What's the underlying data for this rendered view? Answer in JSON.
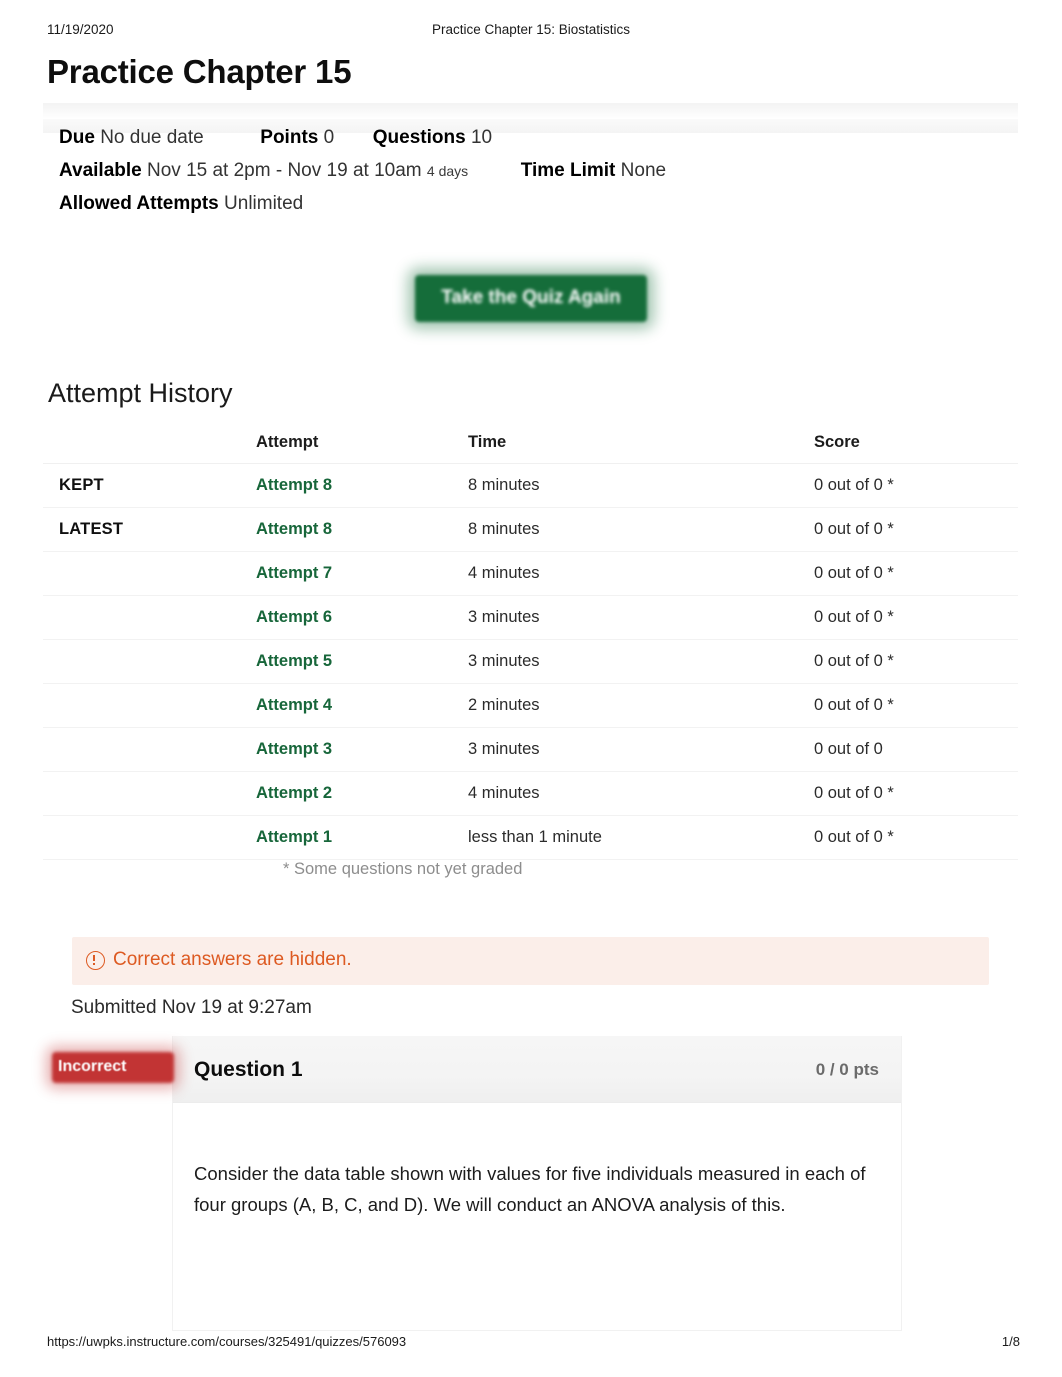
{
  "print": {
    "date": "11/19/2020",
    "doc_title": "Practice Chapter 15: Biostatistics",
    "url": "https://uwpks.instructure.com/courses/325491/quizzes/576093",
    "page_number": "1/8"
  },
  "quiz": {
    "title": "Practice Chapter 15",
    "info": {
      "due_label": "Due",
      "due_value": "No due date",
      "points_label": "Points",
      "points_value": "0",
      "questions_label": "Questions",
      "questions_value": "10",
      "available_label": "Available",
      "available_value": "Nov 15 at 2pm - Nov 19 at 10am",
      "available_duration": "4 days",
      "time_limit_label": "Time Limit",
      "time_limit_value": "None",
      "allowed_attempts_label": "Allowed Attempts",
      "allowed_attempts_value": "Unlimited"
    },
    "take_quiz_button": "Take the Quiz Again"
  },
  "attempt_history": {
    "heading": "Attempt History",
    "columns": [
      "",
      "Attempt",
      "Time",
      "Score"
    ],
    "rows": [
      {
        "marker": "KEPT",
        "attempt": "Attempt 8",
        "time": "8 minutes",
        "score": "0 out of 0 *"
      },
      {
        "marker": "LATEST",
        "attempt": "Attempt 8",
        "time": "8 minutes",
        "score": "0 out of 0 *"
      },
      {
        "marker": "",
        "attempt": "Attempt 7",
        "time": "4 minutes",
        "score": "0 out of 0 *"
      },
      {
        "marker": "",
        "attempt": "Attempt 6",
        "time": "3 minutes",
        "score": "0 out of 0 *"
      },
      {
        "marker": "",
        "attempt": "Attempt 5",
        "time": "3 minutes",
        "score": "0 out of 0 *"
      },
      {
        "marker": "",
        "attempt": "Attempt 4",
        "time": "2 minutes",
        "score": "0 out of 0 *"
      },
      {
        "marker": "",
        "attempt": "Attempt 3",
        "time": "3 minutes",
        "score": "0 out of 0"
      },
      {
        "marker": "",
        "attempt": "Attempt 2",
        "time": "4 minutes",
        "score": "0 out of 0 *"
      },
      {
        "marker": "",
        "attempt": "Attempt 1",
        "time": "less than 1 minute",
        "score": "0 out of 0 *"
      }
    ],
    "footnote": "* Some questions not yet graded"
  },
  "alert": {
    "icon": "exclamation-circle-icon",
    "text": "Correct answers are hidden."
  },
  "submitted": "Submitted Nov 19 at 9:27am",
  "question": {
    "status_badge": "Incorrect",
    "name": "Question 1",
    "points": "0 / 0 pts",
    "body": "Consider the data table shown with values for five individuals measured in each of four groups (A, B, C, and D). We will conduct an ANOVA analysis of this."
  },
  "colors": {
    "link_green": "#17663a",
    "button_green": "#156d3a",
    "alert_orange": "#dd5a22",
    "badge_red": "#c23434",
    "alert_bg": "#fbeee9"
  }
}
